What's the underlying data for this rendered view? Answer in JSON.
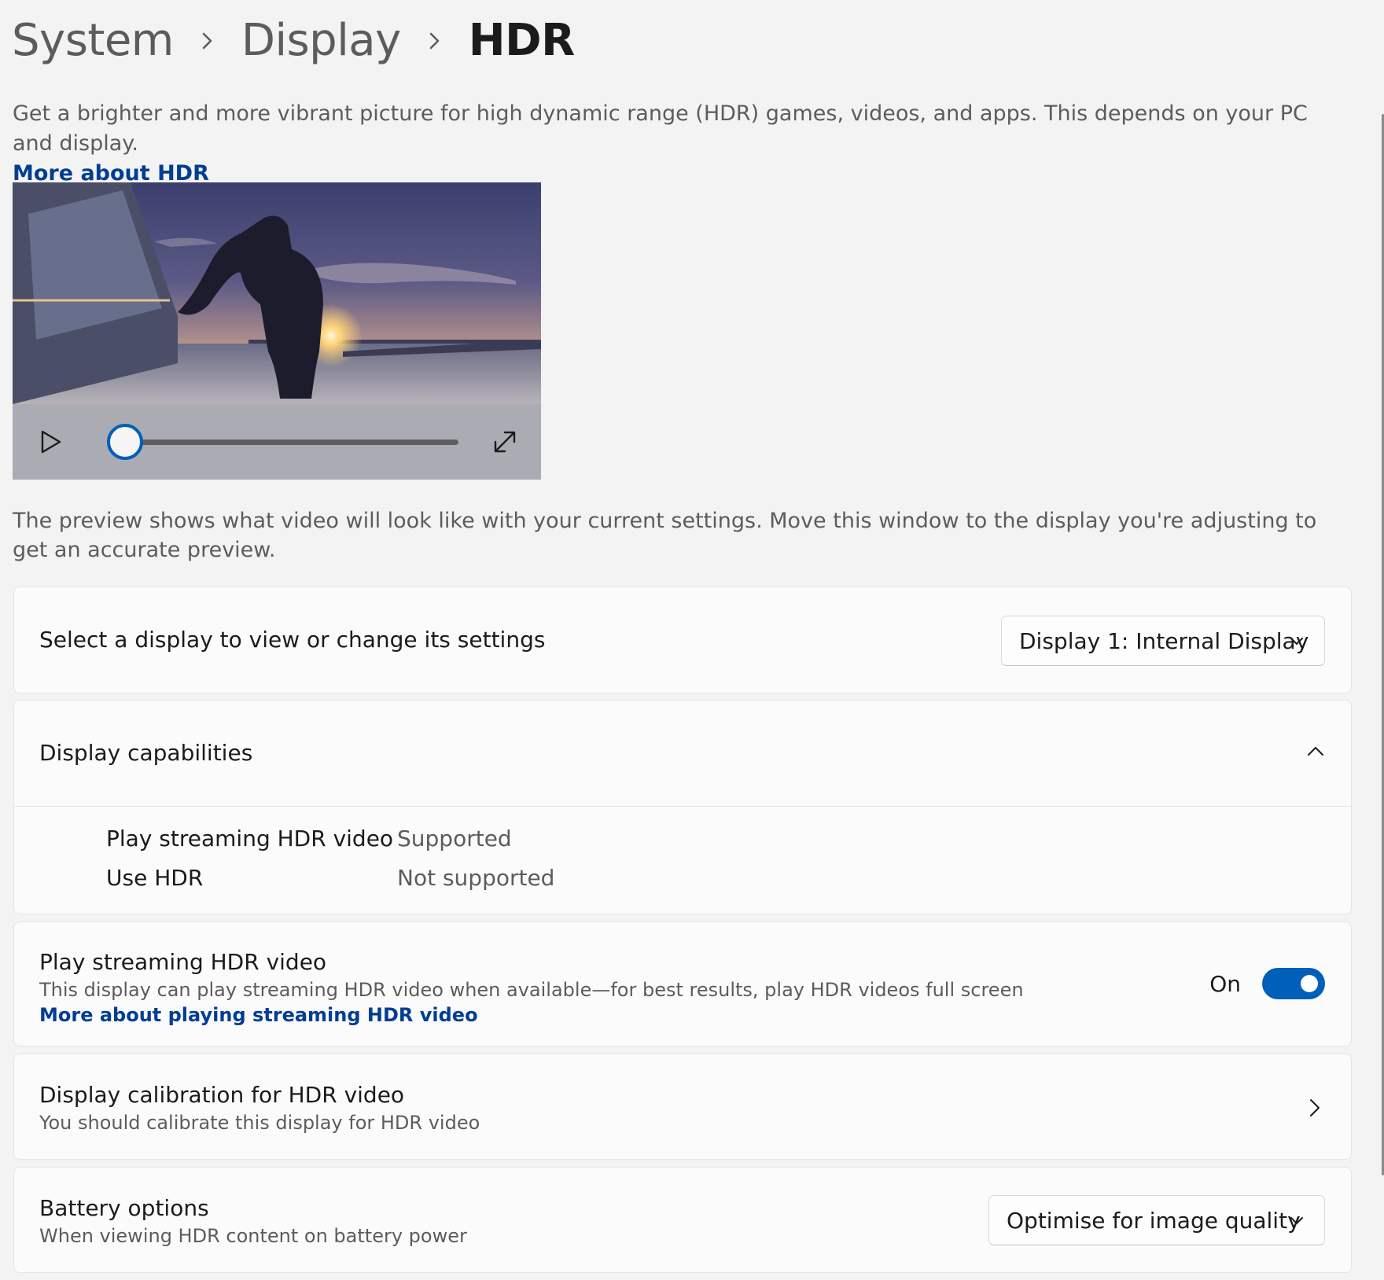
{
  "breadcrumb": {
    "items": [
      "System",
      "Display"
    ],
    "current": "HDR"
  },
  "intro": {
    "text": "Get a brighter and more vibrant picture for high dynamic range (HDR) games, videos, and apps. This depends on your PC and display.",
    "link": "More about HDR"
  },
  "video": {
    "progress": 0
  },
  "preview_note": "The preview shows what video will look like with your current settings. Move this window to the display you're adjusting to get an accurate preview.",
  "display_select": {
    "label": "Select a display to view or change its settings",
    "value": "Display 1: Internal Display"
  },
  "capabilities": {
    "title": "Display capabilities",
    "rows": [
      {
        "name": "Play streaming HDR video",
        "status": "Supported"
      },
      {
        "name": "Use HDR",
        "status": "Not supported"
      }
    ]
  },
  "streaming": {
    "title": "Play streaming HDR video",
    "description": "This display can play streaming HDR video when available—for best results, play HDR videos full screen",
    "link": "More about playing streaming HDR video",
    "state_label": "On",
    "enabled": true
  },
  "calibration": {
    "title": "Display calibration for HDR video",
    "subtitle": "You should calibrate this display for HDR video"
  },
  "battery": {
    "title": "Battery options",
    "subtitle": "When viewing HDR content on battery power",
    "value": "Optimise for image quality"
  },
  "colors": {
    "accent": "#005fb8",
    "link": "#003e92",
    "background": "#f3f3f3",
    "card": "#fbfbfb"
  }
}
